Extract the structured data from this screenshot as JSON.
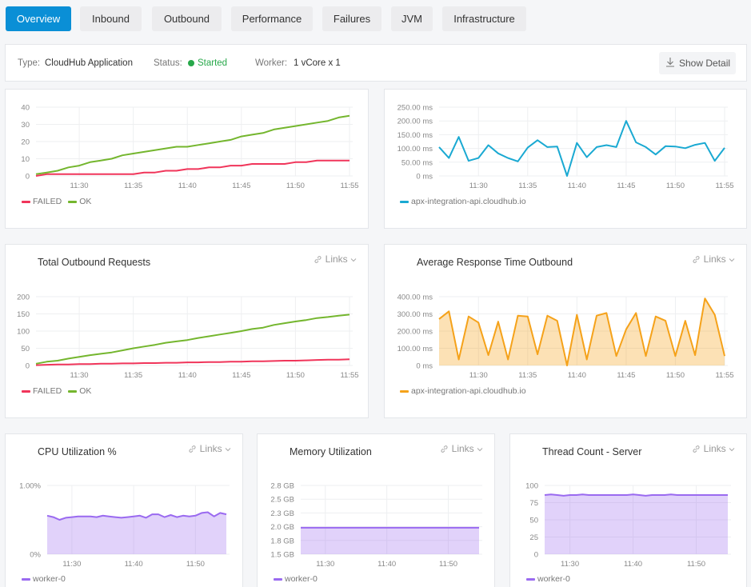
{
  "tabs": [
    {
      "label": "Overview",
      "active": true
    },
    {
      "label": "Inbound",
      "active": false
    },
    {
      "label": "Outbound",
      "active": false
    },
    {
      "label": "Performance",
      "active": false
    },
    {
      "label": "Failures",
      "active": false
    },
    {
      "label": "JVM",
      "active": false
    },
    {
      "label": "Infrastructure",
      "active": false
    }
  ],
  "info": {
    "type_label": "Type:",
    "type_value": "CloudHub Application",
    "status_label": "Status:",
    "status_value": "Started",
    "status_color": "#27a84a",
    "worker_label": "Worker:",
    "worker_value": "1 vCore x 1",
    "show_detail_label": "Show Detail",
    "show_detail_icon": "download-icon"
  },
  "links_label": "Links",
  "colors": {
    "failed": "#f0355a",
    "ok": "#74b62e",
    "inbound_latency": "#1aa9d2",
    "outbound_latency": "#f5a21a",
    "worker": "#9a6af0",
    "primary": "#0a8fd6"
  },
  "chart_data": [
    {
      "id": "inbound-requests",
      "title": "",
      "type": "line",
      "x": [
        "11:26",
        "11:27",
        "11:28",
        "11:29",
        "11:30",
        "11:31",
        "11:32",
        "11:33",
        "11:34",
        "11:35",
        "11:36",
        "11:37",
        "11:38",
        "11:39",
        "11:40",
        "11:41",
        "11:42",
        "11:43",
        "11:44",
        "11:45",
        "11:46",
        "11:47",
        "11:48",
        "11:49",
        "11:50",
        "11:51",
        "11:52",
        "11:53",
        "11:54",
        "11:55"
      ],
      "xticks": [
        "11:30",
        "11:35",
        "11:40",
        "11:45",
        "11:50",
        "11:55"
      ],
      "yticks": [
        "0",
        "10",
        "20",
        "30",
        "40"
      ],
      "ylim": [
        0,
        40
      ],
      "series": [
        {
          "name": "FAILED",
          "color": "#f0355a",
          "values": [
            0,
            1,
            1,
            1,
            1,
            1,
            1,
            1,
            1,
            1,
            2,
            2,
            3,
            3,
            4,
            4,
            5,
            5,
            6,
            6,
            7,
            7,
            7,
            7,
            8,
            8,
            9,
            9,
            9,
            9
          ]
        },
        {
          "name": "OK",
          "color": "#74b62e",
          "values": [
            1,
            2,
            3,
            5,
            6,
            8,
            9,
            10,
            12,
            13,
            14,
            15,
            16,
            17,
            17,
            18,
            19,
            20,
            21,
            23,
            24,
            25,
            27,
            28,
            29,
            30,
            31,
            32,
            34,
            35
          ]
        }
      ]
    },
    {
      "id": "inbound-response-time",
      "title": "",
      "type": "line",
      "x": [
        "11:26",
        "11:27",
        "11:28",
        "11:29",
        "11:30",
        "11:31",
        "11:32",
        "11:33",
        "11:34",
        "11:35",
        "11:36",
        "11:37",
        "11:38",
        "11:39",
        "11:40",
        "11:41",
        "11:42",
        "11:43",
        "11:44",
        "11:45",
        "11:46",
        "11:47",
        "11:48",
        "11:49",
        "11:50",
        "11:51",
        "11:52",
        "11:53",
        "11:54",
        "11:55"
      ],
      "xticks": [
        "11:30",
        "11:35",
        "11:40",
        "11:45",
        "11:50",
        "11:55"
      ],
      "yticks": [
        "0 ms",
        "50.00 ms",
        "100.00 ms",
        "150.00 ms",
        "200.00 ms",
        "250.00 ms"
      ],
      "ylim": [
        0,
        250
      ],
      "series": [
        {
          "name": "apx-integration-api.cloudhub.io",
          "color": "#1aa9d2",
          "values": [
            105,
            65,
            142,
            55,
            65,
            112,
            82,
            65,
            53,
            103,
            130,
            105,
            107,
            0,
            120,
            68,
            105,
            112,
            105,
            200,
            122,
            105,
            78,
            108,
            107,
            101,
            113,
            120,
            55,
            102
          ]
        }
      ]
    },
    {
      "id": "total-outbound-requests",
      "title": "Total Outbound Requests",
      "type": "line",
      "x": [
        "11:26",
        "11:27",
        "11:28",
        "11:29",
        "11:30",
        "11:31",
        "11:32",
        "11:33",
        "11:34",
        "11:35",
        "11:36",
        "11:37",
        "11:38",
        "11:39",
        "11:40",
        "11:41",
        "11:42",
        "11:43",
        "11:44",
        "11:45",
        "11:46",
        "11:47",
        "11:48",
        "11:49",
        "11:50",
        "11:51",
        "11:52",
        "11:53",
        "11:54",
        "11:55"
      ],
      "xticks": [
        "11:30",
        "11:35",
        "11:40",
        "11:45",
        "11:50",
        "11:55"
      ],
      "yticks": [
        "0",
        "50",
        "100",
        "150",
        "200"
      ],
      "ylim": [
        0,
        200
      ],
      "series": [
        {
          "name": "FAILED",
          "color": "#f0355a",
          "values": [
            1,
            2,
            3,
            3,
            4,
            4,
            5,
            5,
            6,
            6,
            7,
            7,
            8,
            8,
            9,
            9,
            10,
            10,
            11,
            11,
            12,
            12,
            13,
            14,
            14,
            15,
            16,
            17,
            17,
            18
          ]
        },
        {
          "name": "OK",
          "color": "#74b62e",
          "values": [
            5,
            11,
            14,
            20,
            25,
            30,
            34,
            38,
            44,
            50,
            55,
            60,
            66,
            70,
            74,
            80,
            85,
            90,
            95,
            100,
            106,
            110,
            118,
            123,
            128,
            132,
            138,
            141,
            145,
            148
          ]
        }
      ]
    },
    {
      "id": "average-response-time-outbound",
      "title": "Average Response Time Outbound",
      "type": "area",
      "x": [
        "11:26",
        "11:27",
        "11:28",
        "11:29",
        "11:30",
        "11:31",
        "11:32",
        "11:33",
        "11:34",
        "11:35",
        "11:36",
        "11:37",
        "11:38",
        "11:39",
        "11:40",
        "11:41",
        "11:42",
        "11:43",
        "11:44",
        "11:45",
        "11:46",
        "11:47",
        "11:48",
        "11:49",
        "11:50",
        "11:51",
        "11:52",
        "11:53",
        "11:54",
        "11:55"
      ],
      "xticks": [
        "11:30",
        "11:35",
        "11:40",
        "11:45",
        "11:50",
        "11:55"
      ],
      "yticks": [
        "0 ms",
        "100.00 ms",
        "200.00 ms",
        "300.00 ms",
        "400.00 ms"
      ],
      "ylim": [
        0,
        400
      ],
      "series": [
        {
          "name": "apx-integration-api.cloudhub.io",
          "color": "#f5a21a",
          "values": [
            270,
            315,
            35,
            285,
            250,
            60,
            255,
            35,
            290,
            285,
            65,
            290,
            260,
            0,
            295,
            35,
            290,
            305,
            55,
            210,
            305,
            55,
            285,
            260,
            55,
            260,
            60,
            390,
            295,
            55
          ]
        }
      ]
    },
    {
      "id": "cpu-utilization",
      "title": "CPU Utilization %",
      "type": "area",
      "x": [
        "11:26",
        "11:27",
        "11:28",
        "11:29",
        "11:30",
        "11:31",
        "11:32",
        "11:33",
        "11:34",
        "11:35",
        "11:36",
        "11:37",
        "11:38",
        "11:39",
        "11:40",
        "11:41",
        "11:42",
        "11:43",
        "11:44",
        "11:45",
        "11:46",
        "11:47",
        "11:48",
        "11:49",
        "11:50",
        "11:51",
        "11:52",
        "11:53",
        "11:54",
        "11:55"
      ],
      "xticks": [
        "11:30",
        "11:40",
        "11:50"
      ],
      "yticks": [
        "0%",
        "1.00%"
      ],
      "ylim": [
        0,
        1.0
      ],
      "series": [
        {
          "name": "worker-0",
          "color": "#9a6af0",
          "values": [
            0.56,
            0.54,
            0.5,
            0.53,
            0.54,
            0.55,
            0.55,
            0.55,
            0.54,
            0.56,
            0.55,
            0.54,
            0.53,
            0.54,
            0.55,
            0.56,
            0.53,
            0.58,
            0.58,
            0.54,
            0.57,
            0.54,
            0.56,
            0.55,
            0.56,
            0.6,
            0.61,
            0.55,
            0.6,
            0.58
          ]
        }
      ]
    },
    {
      "id": "memory-utilization",
      "title": "Memory Utilization",
      "type": "area",
      "x": [
        "11:26",
        "11:55"
      ],
      "xticks": [
        "11:30",
        "11:40",
        "11:50"
      ],
      "yticks": [
        "1.5 GB",
        "1.8 GB",
        "2.0 GB",
        "2.3 GB",
        "2.5 GB",
        "2.8 GB"
      ],
      "ylim": [
        1.5,
        2.8
      ],
      "series": [
        {
          "name": "worker-0",
          "color": "#9a6af0",
          "values": [
            2.0,
            2.0
          ]
        }
      ]
    },
    {
      "id": "thread-count-server",
      "title": "Thread Count - Server",
      "type": "area",
      "x": [
        "11:26",
        "11:27",
        "11:28",
        "11:29",
        "11:30",
        "11:31",
        "11:32",
        "11:33",
        "11:34",
        "11:35",
        "11:36",
        "11:37",
        "11:38",
        "11:39",
        "11:40",
        "11:41",
        "11:42",
        "11:43",
        "11:44",
        "11:45",
        "11:46",
        "11:47",
        "11:48",
        "11:49",
        "11:50",
        "11:51",
        "11:52",
        "11:53",
        "11:54",
        "11:55"
      ],
      "xticks": [
        "11:30",
        "11:40",
        "11:50"
      ],
      "yticks": [
        "0",
        "25",
        "50",
        "75",
        "100"
      ],
      "ylim": [
        0,
        100
      ],
      "series": [
        {
          "name": "worker-0",
          "color": "#9a6af0",
          "values": [
            86,
            87,
            86,
            85,
            86,
            86,
            87,
            86,
            86,
            86,
            86,
            86,
            86,
            86,
            87,
            86,
            85,
            86,
            86,
            86,
            87,
            86,
            86,
            86,
            86,
            86,
            86,
            86,
            86,
            86
          ]
        }
      ]
    }
  ]
}
